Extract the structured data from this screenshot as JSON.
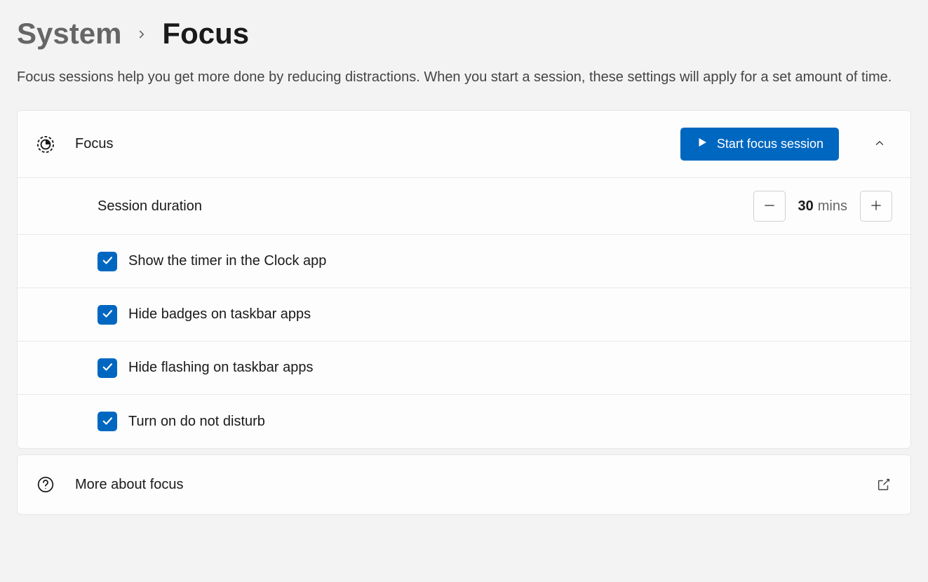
{
  "breadcrumb": {
    "parent": "System",
    "current": "Focus"
  },
  "description": "Focus sessions help you get more done by reducing distractions. When you start a session, these settings will apply for a set amount of time.",
  "focus": {
    "title": "Focus",
    "start_label": "Start focus session",
    "duration_label": "Session duration",
    "duration_value": "30",
    "duration_unit": "mins",
    "options": [
      {
        "label": "Show the timer in the Clock app",
        "checked": true
      },
      {
        "label": "Hide badges on taskbar apps",
        "checked": true
      },
      {
        "label": "Hide flashing on taskbar apps",
        "checked": true
      },
      {
        "label": "Turn on do not disturb",
        "checked": true
      }
    ]
  },
  "more_label": "More about focus"
}
